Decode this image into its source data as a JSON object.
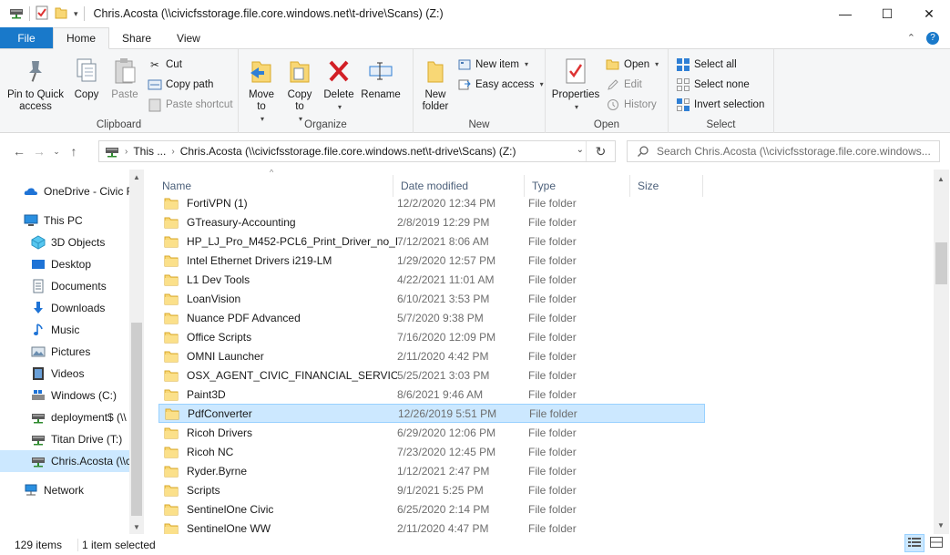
{
  "window": {
    "title": "Chris.Acosta (\\\\civicfsstorage.file.core.windows.net\\t-drive\\Scans) (Z:)",
    "minimize": "—",
    "maximize": "☐",
    "close": "✕"
  },
  "tabs": {
    "file": "File",
    "home": "Home",
    "share": "Share",
    "view": "View"
  },
  "ribbon": {
    "clipboard": {
      "label": "Clipboard",
      "pin": "Pin to Quick access",
      "copy": "Copy",
      "paste": "Paste",
      "cut": "Cut",
      "copy_path": "Copy path",
      "paste_shortcut": "Paste shortcut"
    },
    "organize": {
      "label": "Organize",
      "move_to": "Move to",
      "copy_to": "Copy to",
      "delete": "Delete",
      "rename": "Rename"
    },
    "new": {
      "label": "New",
      "new_folder": "New folder",
      "new_item": "New item",
      "easy_access": "Easy access"
    },
    "open": {
      "label": "Open",
      "properties": "Properties",
      "open": "Open",
      "edit": "Edit",
      "history": "History"
    },
    "select": {
      "label": "Select",
      "select_all": "Select all",
      "select_none": "Select none",
      "invert_selection": "Invert selection"
    }
  },
  "address": {
    "crumb_this": "This ...",
    "crumb_path": "Chris.Acosta (\\\\civicfsstorage.file.core.windows.net\\t-drive\\Scans) (Z:)",
    "search_placeholder": "Search Chris.Acosta (\\\\civicfsstorage.file.core.windows..."
  },
  "nav": {
    "items": [
      {
        "label": "OneDrive - Civic F",
        "icon": "onedrive-icon"
      },
      {
        "label": "This PC",
        "icon": "this-pc-icon"
      },
      {
        "label": "3D Objects",
        "icon": "3d-objects-icon"
      },
      {
        "label": "Desktop",
        "icon": "desktop-icon"
      },
      {
        "label": "Documents",
        "icon": "documents-icon"
      },
      {
        "label": "Downloads",
        "icon": "downloads-icon"
      },
      {
        "label": "Music",
        "icon": "music-icon"
      },
      {
        "label": "Pictures",
        "icon": "pictures-icon"
      },
      {
        "label": "Videos",
        "icon": "videos-icon"
      },
      {
        "label": "Windows (C:)",
        "icon": "windows-drive-icon"
      },
      {
        "label": "deployment$ (\\\\",
        "icon": "network-drive-icon"
      },
      {
        "label": "Titan Drive (T:)",
        "icon": "network-drive-icon"
      },
      {
        "label": "Chris.Acosta (\\\\c",
        "icon": "network-drive-icon"
      },
      {
        "label": "Network",
        "icon": "network-icon"
      }
    ]
  },
  "columns": {
    "name": "Name",
    "date": "Date modified",
    "type": "Type",
    "size": "Size"
  },
  "files": [
    {
      "name": "FortiVPN (1)",
      "date": "12/2/2020 12:34 PM",
      "type": "File folder"
    },
    {
      "name": "GTreasury-Accounting",
      "date": "2/8/2019 12:29 PM",
      "type": "File folder"
    },
    {
      "name": "HP_LJ_Pro_M452-PCL6_Print_Driver_no_I...",
      "date": "7/12/2021 8:06 AM",
      "type": "File folder"
    },
    {
      "name": "Intel Ethernet Drivers i219-LM",
      "date": "1/29/2020 12:57 PM",
      "type": "File folder"
    },
    {
      "name": "L1 Dev Tools",
      "date": "4/22/2021 11:01 AM",
      "type": "File folder"
    },
    {
      "name": "LoanVision",
      "date": "6/10/2021 3:53 PM",
      "type": "File folder"
    },
    {
      "name": "Nuance PDF Advanced",
      "date": "5/7/2020 9:38 PM",
      "type": "File folder"
    },
    {
      "name": "Office Scripts",
      "date": "7/16/2020 12:09 PM",
      "type": "File folder"
    },
    {
      "name": "OMNI Launcher",
      "date": "2/11/2020 4:42 PM",
      "type": "File folder"
    },
    {
      "name": "OSX_AGENT_CIVIC_FINANCIAL_SERVICES...",
      "date": "5/25/2021 3:03 PM",
      "type": "File folder"
    },
    {
      "name": "Paint3D",
      "date": "8/6/2021 9:46 AM",
      "type": "File folder"
    },
    {
      "name": "PdfConverter",
      "date": "12/26/2019 5:51 PM",
      "type": "File folder",
      "selected": true
    },
    {
      "name": "Ricoh Drivers",
      "date": "6/29/2020 12:06 PM",
      "type": "File folder"
    },
    {
      "name": "Ricoh NC",
      "date": "7/23/2020 12:45 PM",
      "type": "File folder"
    },
    {
      "name": "Ryder.Byrne",
      "date": "1/12/2021 2:47 PM",
      "type": "File folder"
    },
    {
      "name": "Scripts",
      "date": "9/1/2021 5:25 PM",
      "type": "File folder"
    },
    {
      "name": "SentinelOne Civic",
      "date": "6/25/2020 2:14 PM",
      "type": "File folder"
    },
    {
      "name": "SentinelOne WW",
      "date": "2/11/2020 4:47 PM",
      "type": "File folder"
    }
  ],
  "status": {
    "count": "129 items",
    "selected": "1 item selected"
  }
}
